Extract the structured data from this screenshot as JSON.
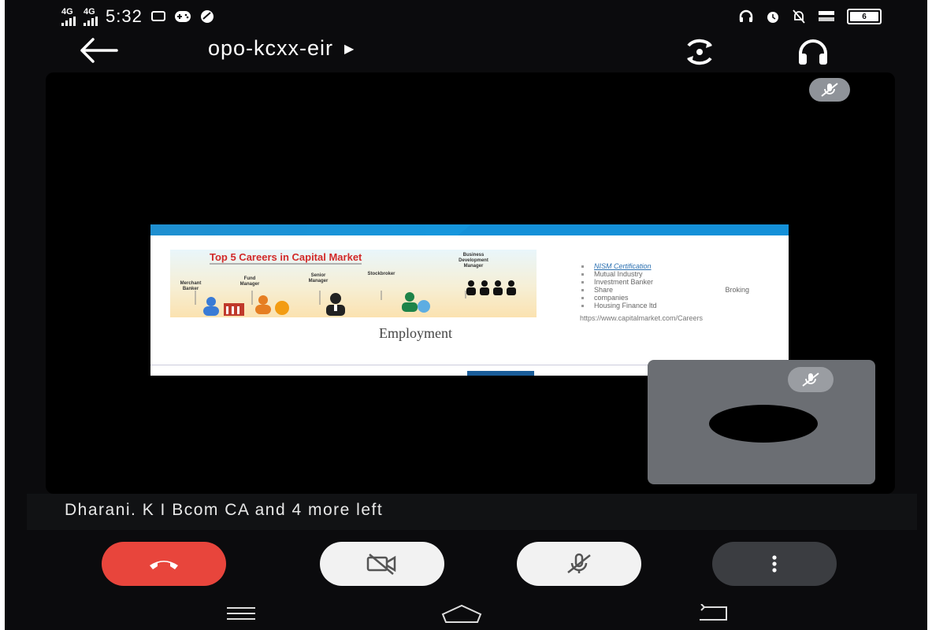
{
  "status_bar": {
    "signal_1": "4G",
    "signal_2": "4G",
    "time": "5:32",
    "battery": "6"
  },
  "header": {
    "meeting_code": "opo-kcxx-eir",
    "icons": [
      "back-arrow-icon",
      "switch-camera-icon",
      "headphones-icon"
    ]
  },
  "slide": {
    "image_title": "Top 5 Careers in Capital Market",
    "roles": [
      "Merchant Banker",
      "Fund Manager",
      "Senior Manager",
      "Stockbroker",
      "Business Development Manager"
    ],
    "caption": "Employment",
    "bullets": [
      "NISM Certification",
      "Mutual Industry",
      "Investment Banker",
      "Share",
      "Broking",
      "companies",
      "Housing Finance ltd"
    ],
    "url": "https://www.capitalmarket.com/Careers"
  },
  "participants": {
    "status_text": "Dharani. K I Bcom CA and 4 more left"
  },
  "controls": {
    "icons": [
      "end-call-icon",
      "camera-off-icon",
      "mic-off-icon",
      "more-options-icon"
    ]
  },
  "colors": {
    "end_call": "#e8453c",
    "control_light": "#f2f2f2",
    "control_dark": "#3b3d41",
    "stage": "#000000"
  }
}
